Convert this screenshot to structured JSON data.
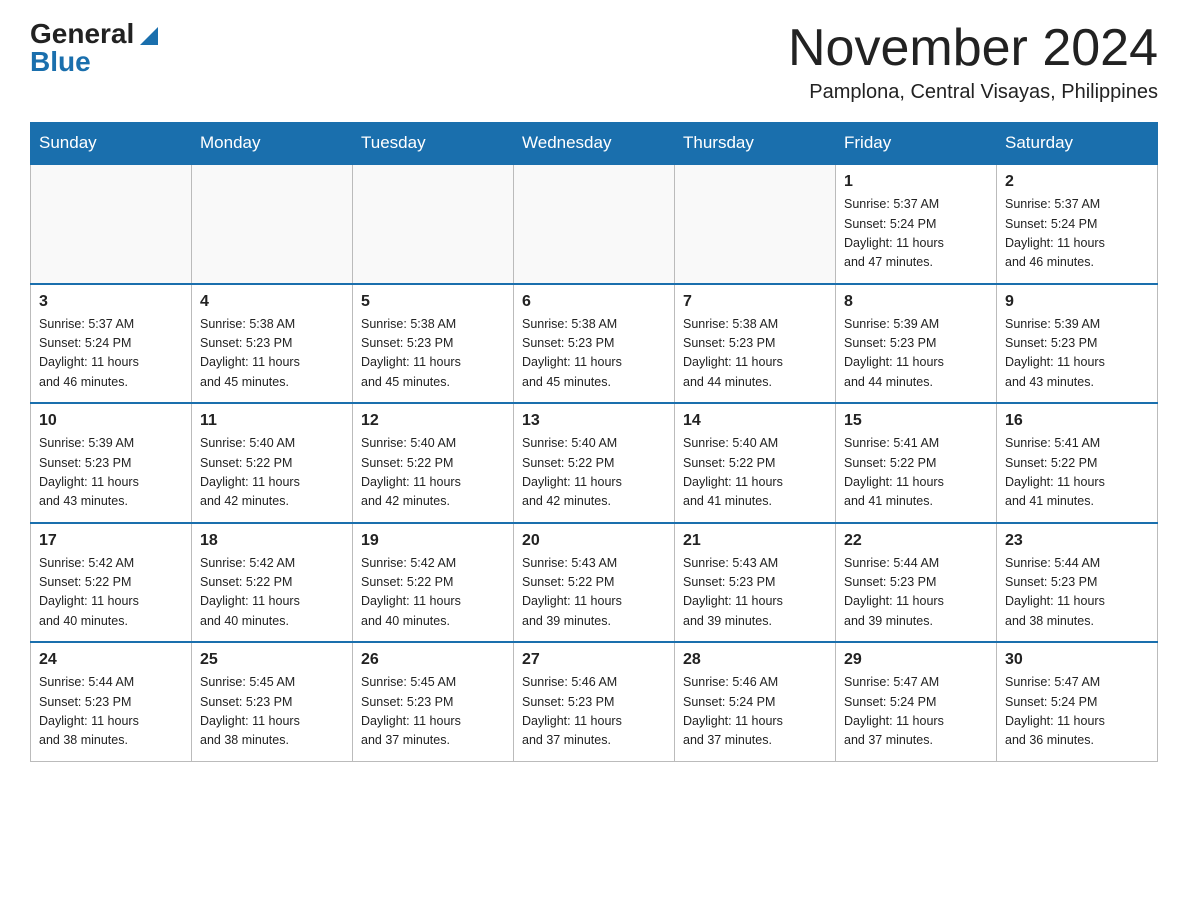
{
  "logo": {
    "general": "General",
    "blue": "Blue"
  },
  "header": {
    "month": "November 2024",
    "location": "Pamplona, Central Visayas, Philippines"
  },
  "days_header": [
    "Sunday",
    "Monday",
    "Tuesday",
    "Wednesday",
    "Thursday",
    "Friday",
    "Saturday"
  ],
  "weeks": [
    [
      {
        "day": "",
        "info": ""
      },
      {
        "day": "",
        "info": ""
      },
      {
        "day": "",
        "info": ""
      },
      {
        "day": "",
        "info": ""
      },
      {
        "day": "",
        "info": ""
      },
      {
        "day": "1",
        "info": "Sunrise: 5:37 AM\nSunset: 5:24 PM\nDaylight: 11 hours\nand 47 minutes."
      },
      {
        "day": "2",
        "info": "Sunrise: 5:37 AM\nSunset: 5:24 PM\nDaylight: 11 hours\nand 46 minutes."
      }
    ],
    [
      {
        "day": "3",
        "info": "Sunrise: 5:37 AM\nSunset: 5:24 PM\nDaylight: 11 hours\nand 46 minutes."
      },
      {
        "day": "4",
        "info": "Sunrise: 5:38 AM\nSunset: 5:23 PM\nDaylight: 11 hours\nand 45 minutes."
      },
      {
        "day": "5",
        "info": "Sunrise: 5:38 AM\nSunset: 5:23 PM\nDaylight: 11 hours\nand 45 minutes."
      },
      {
        "day": "6",
        "info": "Sunrise: 5:38 AM\nSunset: 5:23 PM\nDaylight: 11 hours\nand 45 minutes."
      },
      {
        "day": "7",
        "info": "Sunrise: 5:38 AM\nSunset: 5:23 PM\nDaylight: 11 hours\nand 44 minutes."
      },
      {
        "day": "8",
        "info": "Sunrise: 5:39 AM\nSunset: 5:23 PM\nDaylight: 11 hours\nand 44 minutes."
      },
      {
        "day": "9",
        "info": "Sunrise: 5:39 AM\nSunset: 5:23 PM\nDaylight: 11 hours\nand 43 minutes."
      }
    ],
    [
      {
        "day": "10",
        "info": "Sunrise: 5:39 AM\nSunset: 5:23 PM\nDaylight: 11 hours\nand 43 minutes."
      },
      {
        "day": "11",
        "info": "Sunrise: 5:40 AM\nSunset: 5:22 PM\nDaylight: 11 hours\nand 42 minutes."
      },
      {
        "day": "12",
        "info": "Sunrise: 5:40 AM\nSunset: 5:22 PM\nDaylight: 11 hours\nand 42 minutes."
      },
      {
        "day": "13",
        "info": "Sunrise: 5:40 AM\nSunset: 5:22 PM\nDaylight: 11 hours\nand 42 minutes."
      },
      {
        "day": "14",
        "info": "Sunrise: 5:40 AM\nSunset: 5:22 PM\nDaylight: 11 hours\nand 41 minutes."
      },
      {
        "day": "15",
        "info": "Sunrise: 5:41 AM\nSunset: 5:22 PM\nDaylight: 11 hours\nand 41 minutes."
      },
      {
        "day": "16",
        "info": "Sunrise: 5:41 AM\nSunset: 5:22 PM\nDaylight: 11 hours\nand 41 minutes."
      }
    ],
    [
      {
        "day": "17",
        "info": "Sunrise: 5:42 AM\nSunset: 5:22 PM\nDaylight: 11 hours\nand 40 minutes."
      },
      {
        "day": "18",
        "info": "Sunrise: 5:42 AM\nSunset: 5:22 PM\nDaylight: 11 hours\nand 40 minutes."
      },
      {
        "day": "19",
        "info": "Sunrise: 5:42 AM\nSunset: 5:22 PM\nDaylight: 11 hours\nand 40 minutes."
      },
      {
        "day": "20",
        "info": "Sunrise: 5:43 AM\nSunset: 5:22 PM\nDaylight: 11 hours\nand 39 minutes."
      },
      {
        "day": "21",
        "info": "Sunrise: 5:43 AM\nSunset: 5:23 PM\nDaylight: 11 hours\nand 39 minutes."
      },
      {
        "day": "22",
        "info": "Sunrise: 5:44 AM\nSunset: 5:23 PM\nDaylight: 11 hours\nand 39 minutes."
      },
      {
        "day": "23",
        "info": "Sunrise: 5:44 AM\nSunset: 5:23 PM\nDaylight: 11 hours\nand 38 minutes."
      }
    ],
    [
      {
        "day": "24",
        "info": "Sunrise: 5:44 AM\nSunset: 5:23 PM\nDaylight: 11 hours\nand 38 minutes."
      },
      {
        "day": "25",
        "info": "Sunrise: 5:45 AM\nSunset: 5:23 PM\nDaylight: 11 hours\nand 38 minutes."
      },
      {
        "day": "26",
        "info": "Sunrise: 5:45 AM\nSunset: 5:23 PM\nDaylight: 11 hours\nand 37 minutes."
      },
      {
        "day": "27",
        "info": "Sunrise: 5:46 AM\nSunset: 5:23 PM\nDaylight: 11 hours\nand 37 minutes."
      },
      {
        "day": "28",
        "info": "Sunrise: 5:46 AM\nSunset: 5:24 PM\nDaylight: 11 hours\nand 37 minutes."
      },
      {
        "day": "29",
        "info": "Sunrise: 5:47 AM\nSunset: 5:24 PM\nDaylight: 11 hours\nand 37 minutes."
      },
      {
        "day": "30",
        "info": "Sunrise: 5:47 AM\nSunset: 5:24 PM\nDaylight: 11 hours\nand 36 minutes."
      }
    ]
  ]
}
